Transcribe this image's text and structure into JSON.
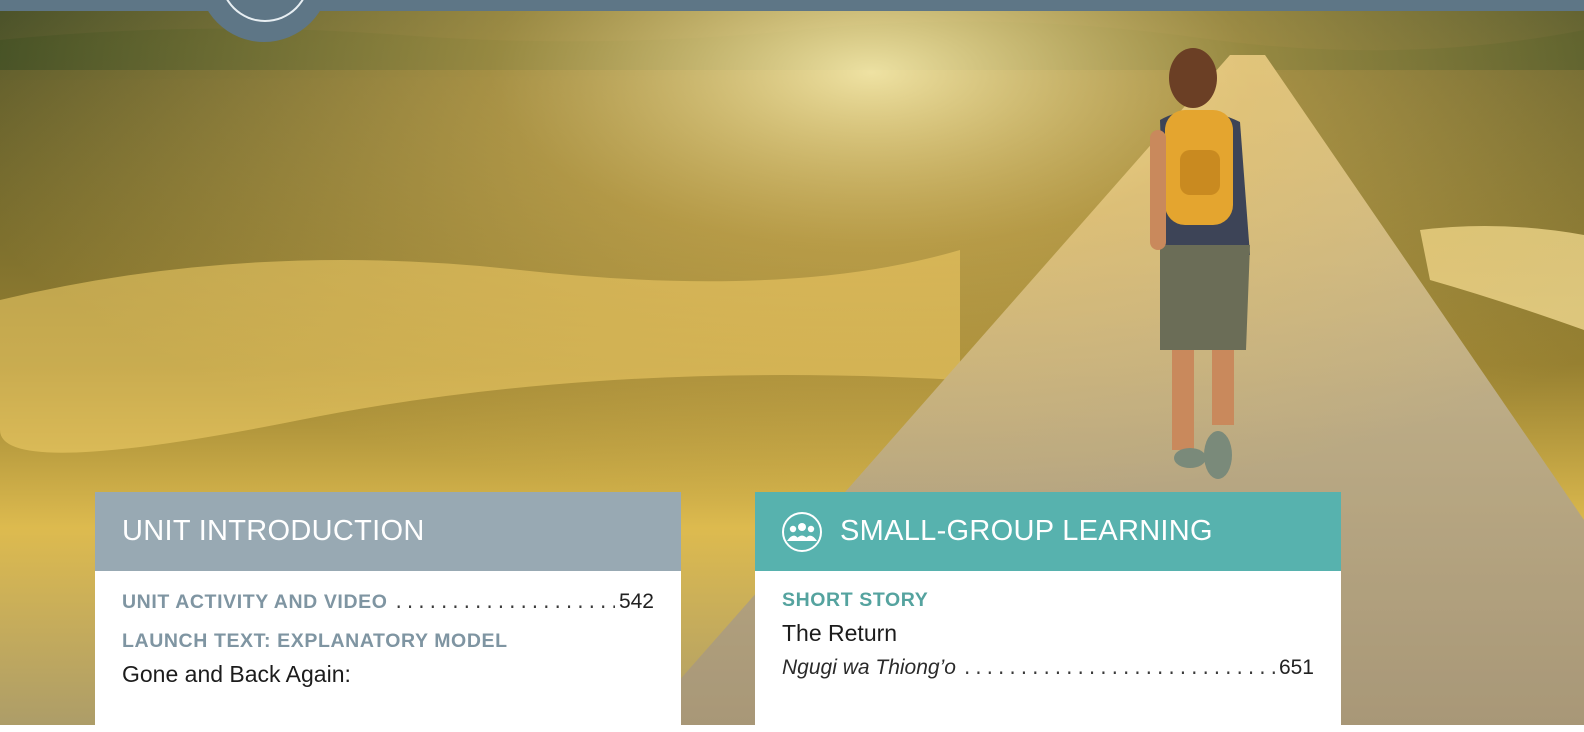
{
  "left_panel": {
    "header": "UNIT INTRODUCTION",
    "entries": [
      {
        "label": "UNIT ACTIVITY AND VIDEO",
        "page": "542"
      },
      {
        "label": "LAUNCH TEXT: EXPLANATORY MODEL",
        "title": "Gone and Back Again:"
      }
    ]
  },
  "right_panel": {
    "icon": "group-icon",
    "header": "SMALL-GROUP LEARNING",
    "entries": [
      {
        "label": "SHORT STORY",
        "title": "The Return",
        "author": "Ngugi wa Thiong’o",
        "page": "651"
      }
    ]
  },
  "colors": {
    "band": "#5e7686",
    "left_header": "#98a9b3",
    "right_header": "#57b2ae",
    "left_label": "#7f95a2",
    "right_label": "#55a39f"
  }
}
